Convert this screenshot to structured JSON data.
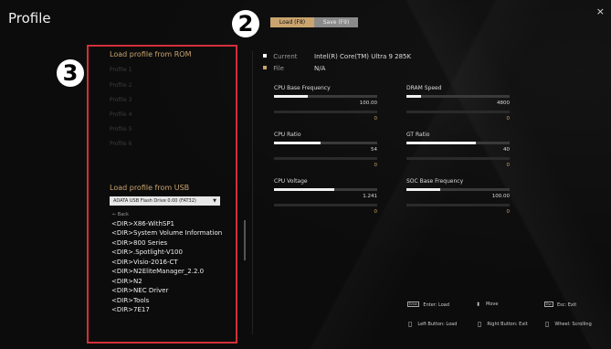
{
  "page": {
    "title": "Profile",
    "close": "×"
  },
  "tabs": [
    {
      "label": "Load (F8)",
      "active": true
    },
    {
      "label": "Save (F9)",
      "active": false
    }
  ],
  "badges": {
    "b2": "2",
    "b3": "3"
  },
  "left": {
    "rom_title": "Load profile from ROM",
    "profiles": [
      "Profile 1",
      "Profile 2",
      "Profile 3",
      "Profile 4",
      "Profile 5",
      "Profile 6"
    ],
    "usb_title": "Load profile from USB",
    "usb_device": "ADATA USB Flash Drive 0.00 (FAT32)",
    "back": "← Back",
    "dirs": [
      "<DIR>X86-WithSP1",
      "<DIR>System Volume Information",
      "<DIR>800 Series",
      "<DIR>.Spotlight-V100",
      "<DIR>Visio-2016-CT",
      "<DIR>N2EliteManager_2.2.0",
      "<DIR>N2",
      "<DIR>NEC Driver",
      "<DIR>Tools",
      "<DIR>7E17"
    ]
  },
  "info": {
    "current_label": "Current",
    "current_value": "Intel(R) Core(TM) Ultra 9 285K",
    "current_color": "#ffffff",
    "file_label": "File",
    "file_value": "N/A",
    "file_color": "#c9a46e"
  },
  "params": [
    {
      "label": "CPU Base Frequency",
      "value": "100.00",
      "compare": "0",
      "fill": 0.33
    },
    {
      "label": "DRAM Speed",
      "value": "4800",
      "compare": "0",
      "fill": 0.14
    },
    {
      "label": "CPU Ratio",
      "value": "54",
      "compare": "0",
      "fill": 0.45
    },
    {
      "label": "GT Ratio",
      "value": "40",
      "compare": "0",
      "fill": 0.67
    },
    {
      "label": "CPU Voltage",
      "value": "1.241",
      "compare": "0",
      "fill": 0.58
    },
    {
      "label": "SOC Base Frequency",
      "value": "100.00",
      "compare": "0",
      "fill": 0.33
    }
  ],
  "help": {
    "enter_key": "Enter",
    "enter": "Enter: Load",
    "move": "Move",
    "esc_key": "Esc",
    "esc": "Esc: Exit",
    "left_button": "Left Button: Load",
    "right_button": "Right Button: Exit",
    "wheel": "Wheel: Scrolling"
  }
}
